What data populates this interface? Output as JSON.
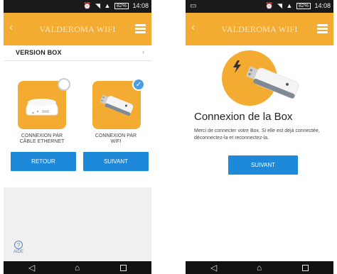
{
  "status_bar": {
    "time": "14:08",
    "battery": "82%"
  },
  "app_bar": {
    "title": "VALDEROMA WIFI",
    "back_glyph": "‹"
  },
  "left_screen": {
    "version_row": {
      "label": "VERSION BOX",
      "chevron": "›"
    },
    "options": [
      {
        "label_line1": "CONNEXION PAR",
        "label_line2": "CÂBLE ETHERNET",
        "selected": false
      },
      {
        "label_line1": "CONNEXION PAR",
        "label_line2": "WIFI",
        "selected": true
      }
    ],
    "buttons": {
      "back": "RETOUR",
      "next": "SUIVANT"
    },
    "help_label": "AIDE"
  },
  "right_screen": {
    "title": "Connexion de la Box",
    "text": "Merci de connecter votre Box. Si elle est déjà connectée, déconnectez-la et reconnectez-la.",
    "next_button": "SUIVANT"
  },
  "colors": {
    "accent": "#f3ac31",
    "button": "#1e88d9",
    "check": "#4a9ce3"
  },
  "icons": [
    "alarm-icon",
    "wifi-icon",
    "signal-icon",
    "battery-icon",
    "menu-icon",
    "usb-wifi-dongle-icon",
    "ethernet-box-icon",
    "help-icon"
  ]
}
